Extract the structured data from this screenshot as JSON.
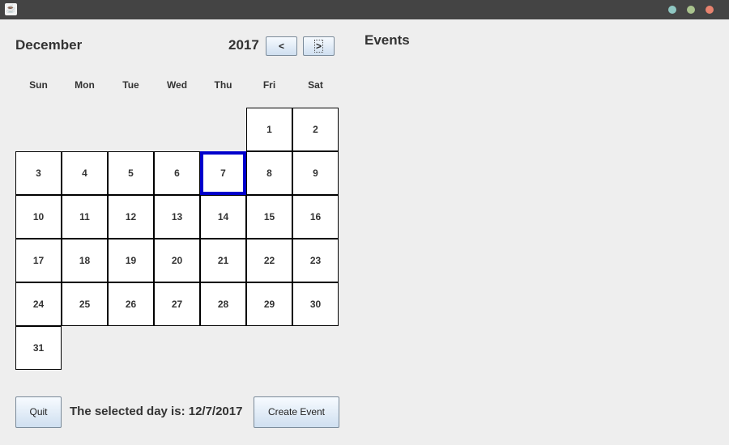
{
  "window": {
    "icon": "java-icon"
  },
  "header": {
    "month": "December",
    "year": "2017",
    "prev_label": "<",
    "next_label": ">"
  },
  "events": {
    "title": "Events"
  },
  "weekdays": [
    "Sun",
    "Mon",
    "Tue",
    "Wed",
    "Thu",
    "Fri",
    "Sat"
  ],
  "calendar": {
    "first_weekday": 5,
    "days_in_month": 31,
    "selected_day": 7
  },
  "footer": {
    "quit_label": "Quit",
    "selected_text": "The selected day is: 12/7/2017",
    "create_label": "Create Event"
  }
}
